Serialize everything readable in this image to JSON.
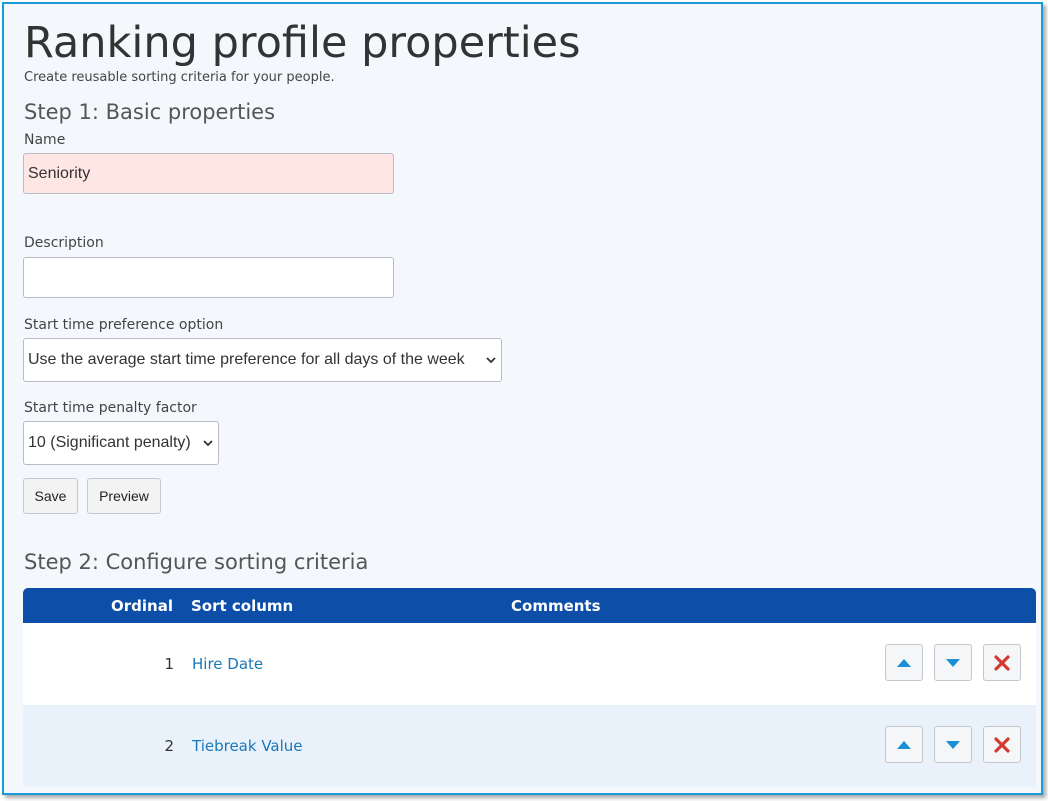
{
  "page": {
    "title": "Ranking profile properties",
    "subtitle": "Create reusable sorting criteria for your people."
  },
  "step1": {
    "heading": "Step 1: Basic properties",
    "name_label": "Name",
    "name_value": "Seniority",
    "description_label": "Description",
    "description_value": "",
    "start_time_pref_label": "Start time preference option",
    "start_time_pref_value": "Use the average start time preference for all days of the week",
    "penalty_label": "Start time penalty factor",
    "penalty_value": "10 (Significant penalty)",
    "save_label": "Save",
    "preview_label": "Preview"
  },
  "step2": {
    "heading": "Step 2: Configure sorting criteria",
    "columns": {
      "ordinal": "Ordinal",
      "sort_column": "Sort column",
      "comments": "Comments"
    },
    "rows": [
      {
        "ordinal": "1",
        "sort_column": "Hire Date",
        "comments": ""
      },
      {
        "ordinal": "2",
        "sort_column": "Tiebreak Value",
        "comments": ""
      }
    ]
  },
  "icons": {
    "move_up": "arrow-up-icon",
    "move_down": "arrow-down-icon",
    "delete": "delete-x-icon",
    "dropdown": "chevron-down-icon"
  },
  "colors": {
    "header_bg": "#0d4fa8",
    "link": "#1a78b8",
    "arrow": "#1a8fd8",
    "delete": "#d43b2f",
    "error_field_bg": "#fde6e4",
    "frame_border": "#1a9ad6"
  }
}
